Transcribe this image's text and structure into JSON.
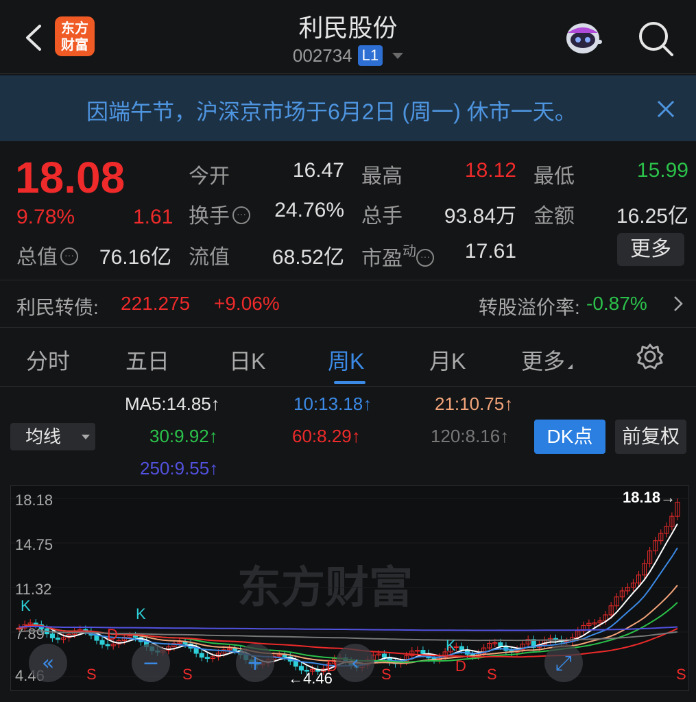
{
  "header": {
    "logo_text": "东方\n财富",
    "logo_line1": "东方",
    "logo_line2": "财富",
    "stock_name": "利民股份",
    "stock_code": "002734",
    "level_badge": "L1",
    "back_icon": "chevron-left-icon",
    "robot_icon": "robot-assistant-icon",
    "search_icon": "search-icon"
  },
  "notice": {
    "text": "因端午节，沪深京市场于6月2日 (周一) 休市一天。",
    "close_icon": "close-icon"
  },
  "quote": {
    "price": "18.08",
    "change_pct": "9.78%",
    "change": "1.61",
    "fields": {
      "open_label": "今开",
      "open_value": "16.47",
      "high_label": "最高",
      "high_value": "18.12",
      "low_label": "最低",
      "low_value": "15.99",
      "turnover_label": "换手",
      "turnover_value": "24.76%",
      "volume_label": "总手",
      "volume_value": "93.84万",
      "amount_label": "金额",
      "amount_value": "16.25亿",
      "mktcap_label": "总值",
      "mktcap_value": "76.16亿",
      "float_label": "流值",
      "float_value": "68.52亿",
      "pe_label": "市盈",
      "pe_sup": "动",
      "pe_value": "17.61"
    },
    "more_button": "更多"
  },
  "bond": {
    "name": "利民转债:",
    "price": "221.275",
    "change": "+9.06%",
    "premium_label": "转股溢价率:",
    "premium_value": "-0.87%"
  },
  "tabs": {
    "items": [
      "分时",
      "五日",
      "日K",
      "周K",
      "月K",
      "更多"
    ],
    "active": "周K",
    "settings_icon": "gear-icon"
  },
  "ma": {
    "selector": "均线",
    "ma5": "MA5:14.85↑",
    "ma10": "10:13.18↑",
    "ma21": "21:10.75↑",
    "ma30": "30:9.92↑",
    "ma60": "60:8.29↑",
    "ma120": "120:8.16↑",
    "ma250": "250:9.55↑",
    "dk_button": "DK点",
    "fuquan_button": "前复权",
    "colors": {
      "ma5": "#ffffff",
      "ma10": "#3b8ae6",
      "ma21": "#f4a57a",
      "ma30": "#2bc24a",
      "ma60": "#ee2a2a",
      "ma120": "#777777",
      "ma250": "#5252e0"
    }
  },
  "chart_data": {
    "type": "candlestick",
    "y_ticks": [
      "18.18",
      "14.75",
      "11.32",
      "7.89",
      "4.46"
    ],
    "max_label": "18.18",
    "min_label": "4.46",
    "watermark": "东方财富",
    "signals": [
      "K",
      "D",
      "K",
      "S",
      "S",
      "K",
      "D",
      "S",
      "D",
      "S",
      "S"
    ],
    "ylim": [
      4.46,
      18.18
    ]
  },
  "chart_controls": {
    "buttons": [
      "pan-left-icon",
      "zoom-out-icon",
      "zoom-in-icon",
      "prev-icon",
      "fullscreen-icon"
    ]
  }
}
